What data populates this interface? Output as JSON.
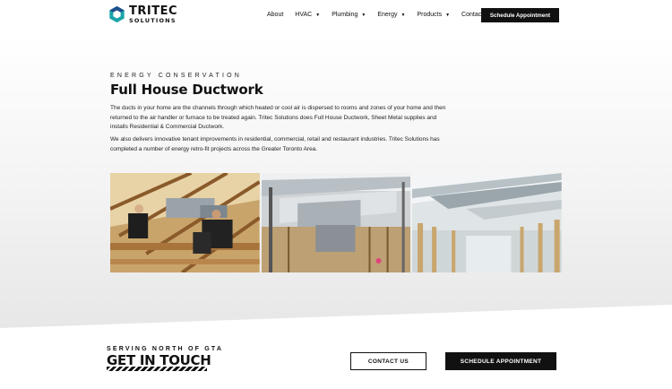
{
  "brand": {
    "name_line1": "TRITEC",
    "name_line2": "SOLUTIONS",
    "colors": {
      "mark_teal": "#1aa3a8",
      "mark_navy": "#1c4f8c",
      "dark": "#111111"
    }
  },
  "nav": {
    "items": [
      {
        "label": "About",
        "has_dropdown": false
      },
      {
        "label": "HVAC",
        "has_dropdown": true
      },
      {
        "label": "Plumbing",
        "has_dropdown": true
      },
      {
        "label": "Energy",
        "has_dropdown": true
      },
      {
        "label": "Products",
        "has_dropdown": true
      },
      {
        "label": "Contact",
        "has_dropdown": false
      }
    ],
    "cta_label": "Schedule Appointment",
    "caret_icon": "chevron-down-icon"
  },
  "hero": {
    "eyebrow": "ENERGY CONSERVATION",
    "title": "Full House Ductwork",
    "paragraph1": "The ducts in your home are the channels through which heated or cool air is dispersed to rooms and zones of your home and then returned to the air handler or furnace to be treated again. Tritec Solutions does Full House Ductwork, Sheet Metal supplies and installs Residential & Commercial Ductwork.",
    "paragraph2": "We also delivers innovative tenant improvements in residential, commercial, retail and restaurant industries. Tritec Solutions has completed a number of energy retro-fit projects across the Greater Toronto Area."
  },
  "contact": {
    "eyebrow": "SERVING NORTH OF GTA",
    "title": "GET IN TOUCH",
    "contact_button": "CONTACT US",
    "schedule_button": "SCHEDULE APPOINTMENT"
  }
}
